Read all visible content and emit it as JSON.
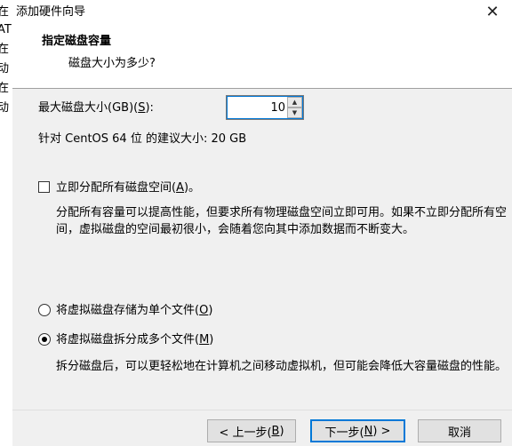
{
  "background_window": {
    "fragments": [
      "在",
      "AT",
      "在",
      "动",
      "在",
      "动"
    ]
  },
  "dialog": {
    "title": "添加硬件向导",
    "close_glyph": "✕"
  },
  "header": {
    "title": "指定磁盘容量",
    "subtitle": "磁盘大小为多少?"
  },
  "disk_size": {
    "label_prefix": "最大磁盘大小(GB)(",
    "label_key": "S",
    "label_suffix": "):",
    "value": "10",
    "recommended": "针对 CentOS 64 位 的建议大小: 20 GB"
  },
  "allocate": {
    "label_prefix": "立即分配所有磁盘空间(",
    "label_key": "A",
    "label_suffix": ")。",
    "checked": false,
    "description": "分配所有容量可以提高性能，但要求所有物理磁盘空间立即可用。如果不立即分配所有空间，虚拟磁盘的空间最初很小，会随着您向其中添加数据而不断变大。"
  },
  "storage": {
    "single": {
      "label_prefix": "将虚拟磁盘存储为单个文件(",
      "label_key": "O",
      "label_suffix": ")",
      "selected": false
    },
    "split": {
      "label_prefix": "将虚拟磁盘拆分成多个文件(",
      "label_key": "M",
      "label_suffix": ")",
      "selected": true,
      "description": "拆分磁盘后，可以更轻松地在计算机之间移动虚拟机，但可能会降低大容量磁盘的性能。"
    }
  },
  "buttons": {
    "back": {
      "prefix": "< 上一步(",
      "key": "B",
      "suffix": ")"
    },
    "next": {
      "prefix": "下一步(",
      "key": "N",
      "suffix": ") >"
    },
    "cancel": {
      "label": "取消"
    }
  },
  "colors": {
    "focus_accent": "#0078d7",
    "dialog_bg": "#f0f0f0",
    "header_bg": "#ffffff"
  }
}
